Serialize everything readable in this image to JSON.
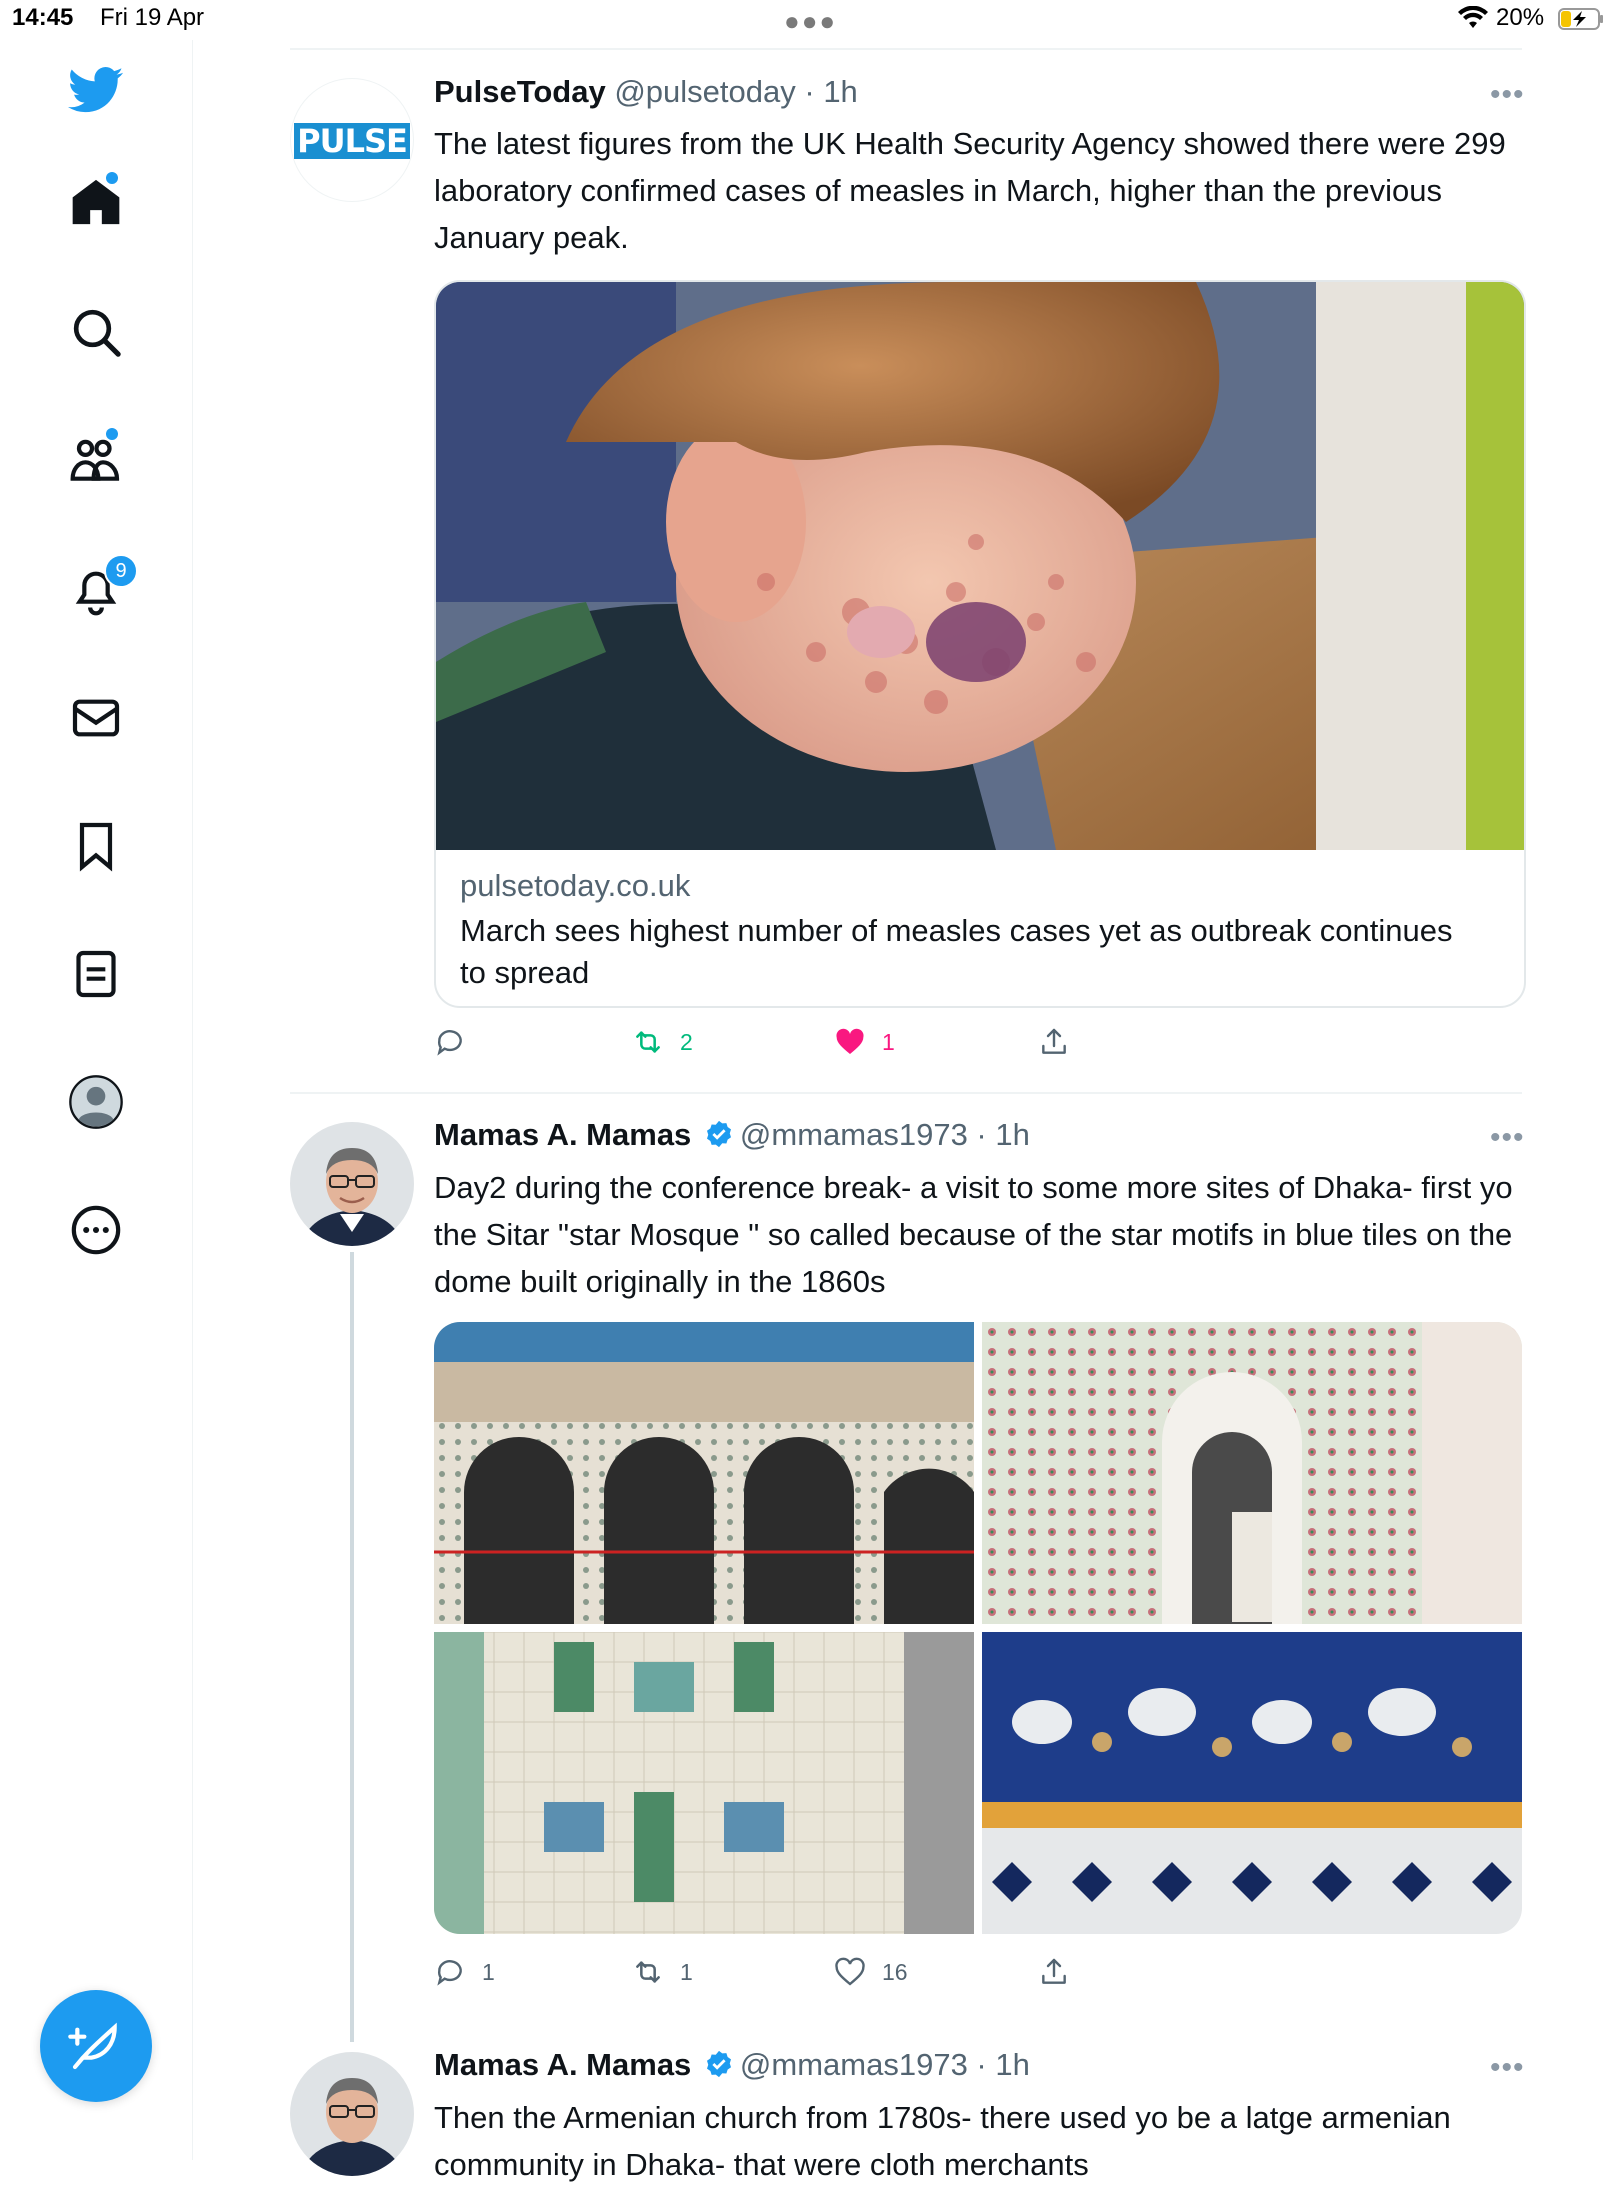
{
  "status_bar": {
    "time": "14:45",
    "date": "Fri 19 Apr",
    "battery_text": "20%",
    "icons": [
      "more-dots-icon",
      "wifi-icon",
      "battery-charging-icon"
    ]
  },
  "sidebar": {
    "items": [
      {
        "name": "twitter-logo-icon"
      },
      {
        "name": "home-icon",
        "dot": true
      },
      {
        "name": "search-icon"
      },
      {
        "name": "communities-icon",
        "dot": true
      },
      {
        "name": "notifications-bell-icon",
        "badge": "9"
      },
      {
        "name": "messages-envelope-icon"
      },
      {
        "name": "bookmark-icon"
      },
      {
        "name": "lists-icon"
      },
      {
        "name": "profile-avatar-icon"
      },
      {
        "name": "more-circle-icon"
      }
    ],
    "compose_icon": "compose-feather-icon"
  },
  "colors": {
    "accent": "#1d9bf0",
    "retweet_active": "#00ba7c",
    "like_active": "#f91880",
    "secondary_text": "#536471"
  },
  "tweets": [
    {
      "name": "PulseToday",
      "handle": "@pulsetoday",
      "dot": " · ",
      "time": "1h",
      "avatar_text": "PULSE",
      "text": "The latest figures from the UK Health Security Agency showed there were 299 laboratory confirmed cases of measles in March, higher than the previous January peak.",
      "card": {
        "domain": "pulsetoday.co.uk",
        "title": "March sees highest number of measles cases yet as outbreak continues to spread"
      },
      "actions": {
        "reply": "",
        "retweet": "2",
        "like": "1"
      }
    },
    {
      "name": "Mamas A. Mamas",
      "handle": "@mmamas1973",
      "dot": " · ",
      "time": "1h",
      "text": "Day2 during the conference break- a visit to some more sites of Dhaka- first yo the Sitar \"star Mosque \" so called because of the star motifs in blue tiles  on the dome built originally in the 1860s",
      "actions": {
        "reply": "1",
        "retweet": "1",
        "like": "16"
      }
    },
    {
      "name": "Mamas A. Mamas",
      "handle": "@mmamas1973",
      "dot": " · ",
      "time": "1h",
      "text": "Then the Armenian church from 1780s- there used yo be a latge armenian community in Dhaka- that were cloth merchants"
    }
  ]
}
